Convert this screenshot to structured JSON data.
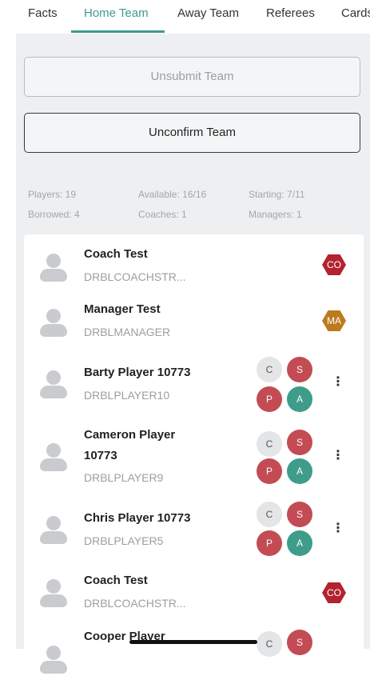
{
  "tabs": [
    "Facts",
    "Home Team",
    "Away Team",
    "Referees",
    "Cards"
  ],
  "buttons": {
    "unsubmit": "Unsubmit Team",
    "unconfirm": "Unconfirm Team"
  },
  "stats": {
    "players": "Players: 19",
    "available": "Available: 16/16",
    "starting": "Starting: 7/11",
    "borrowed": "Borrowed: 4",
    "coaches": "Coaches: 1",
    "managers": "Managers: 1"
  },
  "people": [
    {
      "name": "Coach Test",
      "code": "DRBLCOACHSTR...",
      "badge": "CO"
    },
    {
      "name": "Manager Test",
      "code": "DRBLMANAGER",
      "badge": "MA"
    },
    {
      "name": "Barty Player 10773",
      "code": "DRBLPLAYER10",
      "pills": [
        "C",
        "S",
        "P",
        "A"
      ]
    },
    {
      "name_line1": "Cameron Player",
      "name_line2": "10773",
      "code": "DRBLPLAYER9",
      "pills": [
        "C",
        "S",
        "P",
        "A"
      ]
    },
    {
      "name": "Chris Player 10773",
      "code": "DRBLPLAYER5",
      "pills": [
        "C",
        "S",
        "P",
        "A"
      ]
    },
    {
      "name": "Coach Test",
      "code": "DRBLCOACHSTR...",
      "badge": "CO"
    },
    {
      "name": "Cooper Player",
      "pills": [
        "C",
        "S"
      ]
    }
  ],
  "kebab_symbol": "⋮",
  "colors": {
    "accent": "#3d9c8a",
    "red": "#c24b54",
    "coach_badge": "#b3232f",
    "manager_badge": "#bd7a1f"
  }
}
